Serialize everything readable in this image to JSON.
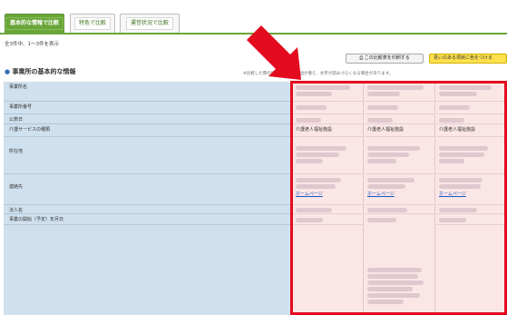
{
  "tabs": [
    {
      "label": "基本的な情報で比較",
      "active": true
    },
    {
      "label": "特色で比較",
      "active": false
    },
    {
      "label": "運営状況で比較",
      "active": false
    }
  ],
  "count_text": "全3件中、1〜3件を表示",
  "actions": {
    "print_label": "この比較表を印刷する",
    "color_label": "見いのある項目に色をつける"
  },
  "section": {
    "title": "事業所の基本的な情報",
    "note": "※比較した際の印刷は、印刷範囲が増え、文字が読みづらくなる場合があります。"
  },
  "rows": [
    {
      "label": "事業所名"
    },
    {
      "label": "事業所番号"
    },
    {
      "label": "公表日"
    },
    {
      "label": "介護サービスの種類"
    },
    {
      "label": "所在地"
    },
    {
      "label": "連絡先"
    },
    {
      "label": "法人名"
    },
    {
      "label": "事業の開始（予定）年月日"
    }
  ],
  "columns": [
    {
      "service_type": "介護老人福祉施設",
      "homepage_link": "ホームページ"
    },
    {
      "service_type": "介護老人福祉施設",
      "homepage_link": "ホームページ"
    },
    {
      "service_type": "介護老人福祉施設",
      "homepage_link": "ホームページ"
    }
  ],
  "colors": {
    "tab_active": "#6aa53a",
    "label_bg": "#cfe0ee",
    "data_bg": "#fbe6e6",
    "highlight_border": "#e30b1e",
    "highlight_button": "#ffe14d",
    "link": "#1a56c4"
  }
}
